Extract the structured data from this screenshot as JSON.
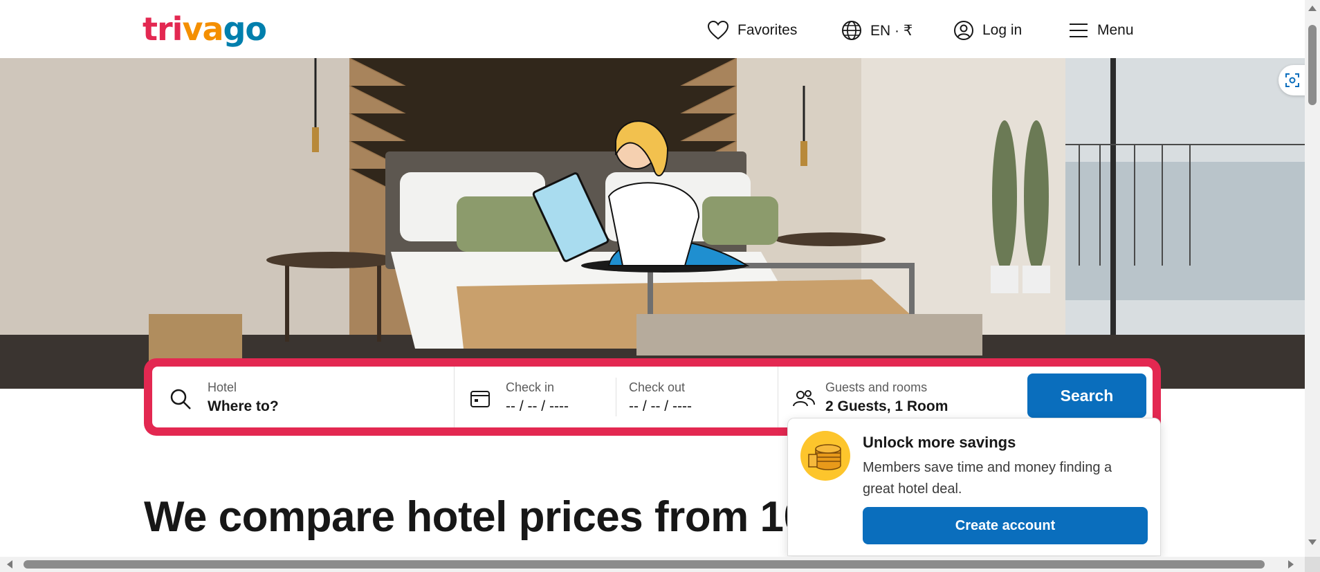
{
  "header": {
    "logo": {
      "part1": "tri",
      "part2": "va",
      "part3": "go"
    },
    "nav": {
      "favorites": "Favorites",
      "language_currency": "EN · ₹",
      "login": "Log in",
      "menu": "Menu"
    }
  },
  "search": {
    "hotel_label": "Hotel",
    "hotel_value": "Where to?",
    "checkin_label": "Check in",
    "checkin_value": "-- / -- / ----",
    "checkout_label": "Check out",
    "checkout_value": "-- / -- / ----",
    "guests_label": "Guests and rooms",
    "guests_value": "2 Guests, 1 Room",
    "button": "Search"
  },
  "popup": {
    "title": "Unlock more savings",
    "body": "Members save time and money finding a great hotel deal.",
    "button": "Create account"
  },
  "main": {
    "headline": "We compare hotel prices from 10"
  },
  "colors": {
    "brand_red": "#e32851",
    "brand_orange": "#f48f00",
    "brand_blue": "#007fad",
    "button_blue": "#0a6ebd",
    "coin_yellow": "#fdc52c"
  },
  "icons": [
    "heart-icon",
    "globe-icon",
    "user-icon",
    "hamburger-icon",
    "search-icon",
    "calendar-icon",
    "guests-icon",
    "coins-icon",
    "scan-icon"
  ]
}
